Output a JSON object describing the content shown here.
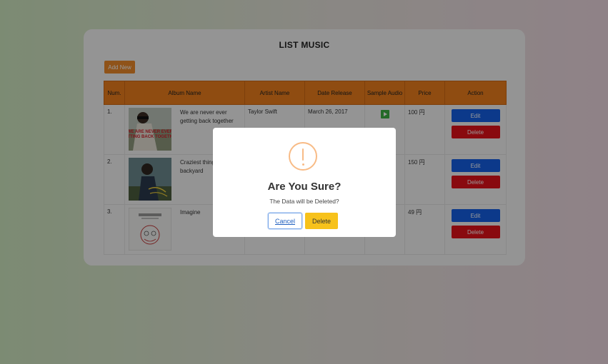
{
  "page": {
    "title": "LIST MUSIC",
    "add_label": "Add New"
  },
  "table": {
    "headers": [
      "Num.",
      "Album Name",
      "Artist Name",
      "Date Release",
      "Sample Audio",
      "Price",
      "Action"
    ],
    "rows": [
      {
        "num": "1.",
        "album": "We are never ever getting back together",
        "artist": "Taylor Swift",
        "date": "March 26, 2017",
        "price": "100 円",
        "cover": "album-cover-1"
      },
      {
        "num": "2.",
        "album": "Craziest thing in my backyard",
        "artist": "",
        "date": "",
        "price": "150 円",
        "cover": "album-cover-2"
      },
      {
        "num": "3.",
        "album": "Imagine",
        "artist": "",
        "date": "",
        "price": "49 円",
        "cover": "album-cover-3"
      }
    ],
    "edit_label": "Edit",
    "delete_label": "Delete",
    "play_icon": "play-icon"
  },
  "modal": {
    "icon": "warning-icon",
    "title": "Are You Sure?",
    "text": "The Data will be Deleted?",
    "cancel_label": "Cancel",
    "delete_label": "Delete"
  },
  "colors": {
    "header": "#ee7f1d",
    "edit": "#1460e6",
    "delete": "#e5111a",
    "confirm": "#f7c21b",
    "play": "#3cb043"
  }
}
